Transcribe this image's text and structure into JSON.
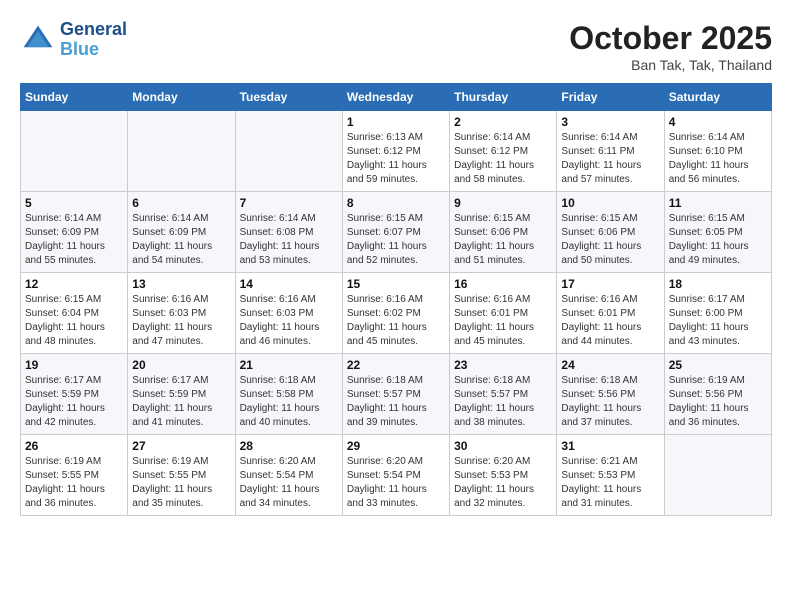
{
  "header": {
    "logo_text_general": "General",
    "logo_text_blue": "Blue",
    "month_title": "October 2025",
    "location": "Ban Tak, Tak, Thailand"
  },
  "weekdays": [
    "Sunday",
    "Monday",
    "Tuesday",
    "Wednesday",
    "Thursday",
    "Friday",
    "Saturday"
  ],
  "weeks": [
    [
      {
        "day": "",
        "info": ""
      },
      {
        "day": "",
        "info": ""
      },
      {
        "day": "",
        "info": ""
      },
      {
        "day": "1",
        "info": "Sunrise: 6:13 AM\nSunset: 6:12 PM\nDaylight: 11 hours\nand 59 minutes."
      },
      {
        "day": "2",
        "info": "Sunrise: 6:14 AM\nSunset: 6:12 PM\nDaylight: 11 hours\nand 58 minutes."
      },
      {
        "day": "3",
        "info": "Sunrise: 6:14 AM\nSunset: 6:11 PM\nDaylight: 11 hours\nand 57 minutes."
      },
      {
        "day": "4",
        "info": "Sunrise: 6:14 AM\nSunset: 6:10 PM\nDaylight: 11 hours\nand 56 minutes."
      }
    ],
    [
      {
        "day": "5",
        "info": "Sunrise: 6:14 AM\nSunset: 6:09 PM\nDaylight: 11 hours\nand 55 minutes."
      },
      {
        "day": "6",
        "info": "Sunrise: 6:14 AM\nSunset: 6:09 PM\nDaylight: 11 hours\nand 54 minutes."
      },
      {
        "day": "7",
        "info": "Sunrise: 6:14 AM\nSunset: 6:08 PM\nDaylight: 11 hours\nand 53 minutes."
      },
      {
        "day": "8",
        "info": "Sunrise: 6:15 AM\nSunset: 6:07 PM\nDaylight: 11 hours\nand 52 minutes."
      },
      {
        "day": "9",
        "info": "Sunrise: 6:15 AM\nSunset: 6:06 PM\nDaylight: 11 hours\nand 51 minutes."
      },
      {
        "day": "10",
        "info": "Sunrise: 6:15 AM\nSunset: 6:06 PM\nDaylight: 11 hours\nand 50 minutes."
      },
      {
        "day": "11",
        "info": "Sunrise: 6:15 AM\nSunset: 6:05 PM\nDaylight: 11 hours\nand 49 minutes."
      }
    ],
    [
      {
        "day": "12",
        "info": "Sunrise: 6:15 AM\nSunset: 6:04 PM\nDaylight: 11 hours\nand 48 minutes."
      },
      {
        "day": "13",
        "info": "Sunrise: 6:16 AM\nSunset: 6:03 PM\nDaylight: 11 hours\nand 47 minutes."
      },
      {
        "day": "14",
        "info": "Sunrise: 6:16 AM\nSunset: 6:03 PM\nDaylight: 11 hours\nand 46 minutes."
      },
      {
        "day": "15",
        "info": "Sunrise: 6:16 AM\nSunset: 6:02 PM\nDaylight: 11 hours\nand 45 minutes."
      },
      {
        "day": "16",
        "info": "Sunrise: 6:16 AM\nSunset: 6:01 PM\nDaylight: 11 hours\nand 45 minutes."
      },
      {
        "day": "17",
        "info": "Sunrise: 6:16 AM\nSunset: 6:01 PM\nDaylight: 11 hours\nand 44 minutes."
      },
      {
        "day": "18",
        "info": "Sunrise: 6:17 AM\nSunset: 6:00 PM\nDaylight: 11 hours\nand 43 minutes."
      }
    ],
    [
      {
        "day": "19",
        "info": "Sunrise: 6:17 AM\nSunset: 5:59 PM\nDaylight: 11 hours\nand 42 minutes."
      },
      {
        "day": "20",
        "info": "Sunrise: 6:17 AM\nSunset: 5:59 PM\nDaylight: 11 hours\nand 41 minutes."
      },
      {
        "day": "21",
        "info": "Sunrise: 6:18 AM\nSunset: 5:58 PM\nDaylight: 11 hours\nand 40 minutes."
      },
      {
        "day": "22",
        "info": "Sunrise: 6:18 AM\nSunset: 5:57 PM\nDaylight: 11 hours\nand 39 minutes."
      },
      {
        "day": "23",
        "info": "Sunrise: 6:18 AM\nSunset: 5:57 PM\nDaylight: 11 hours\nand 38 minutes."
      },
      {
        "day": "24",
        "info": "Sunrise: 6:18 AM\nSunset: 5:56 PM\nDaylight: 11 hours\nand 37 minutes."
      },
      {
        "day": "25",
        "info": "Sunrise: 6:19 AM\nSunset: 5:56 PM\nDaylight: 11 hours\nand 36 minutes."
      }
    ],
    [
      {
        "day": "26",
        "info": "Sunrise: 6:19 AM\nSunset: 5:55 PM\nDaylight: 11 hours\nand 36 minutes."
      },
      {
        "day": "27",
        "info": "Sunrise: 6:19 AM\nSunset: 5:55 PM\nDaylight: 11 hours\nand 35 minutes."
      },
      {
        "day": "28",
        "info": "Sunrise: 6:20 AM\nSunset: 5:54 PM\nDaylight: 11 hours\nand 34 minutes."
      },
      {
        "day": "29",
        "info": "Sunrise: 6:20 AM\nSunset: 5:54 PM\nDaylight: 11 hours\nand 33 minutes."
      },
      {
        "day": "30",
        "info": "Sunrise: 6:20 AM\nSunset: 5:53 PM\nDaylight: 11 hours\nand 32 minutes."
      },
      {
        "day": "31",
        "info": "Sunrise: 6:21 AM\nSunset: 5:53 PM\nDaylight: 11 hours\nand 31 minutes."
      },
      {
        "day": "",
        "info": ""
      }
    ]
  ]
}
